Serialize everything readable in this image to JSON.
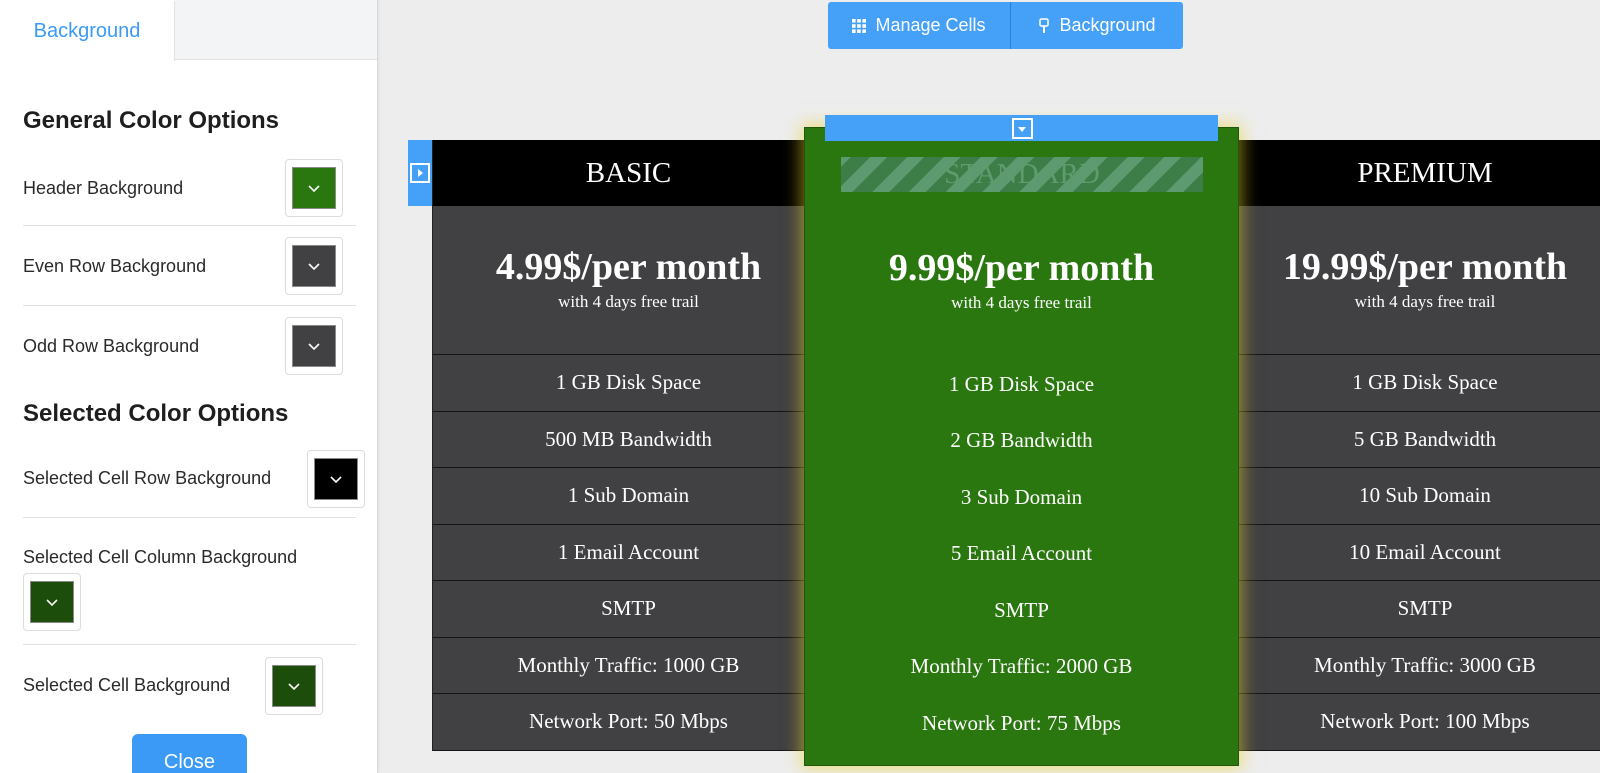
{
  "panel": {
    "tab_label": "Background",
    "general_title": "General Color Options",
    "selected_title": "Selected Color Options",
    "close_label": "Close",
    "options": [
      {
        "label": "Header Background",
        "color": "#2a7710"
      },
      {
        "label": "Even Row Background",
        "color": "#414042"
      },
      {
        "label": "Odd Row Background",
        "color": "#414042"
      },
      {
        "label": "Selected Cell Row Background",
        "color": "#000000"
      },
      {
        "label": "Selected Cell Column Background",
        "color": "#1d4d0a"
      },
      {
        "label": "Selected Cell Background",
        "color": "#1d4d0a"
      }
    ]
  },
  "toolbar": {
    "manage_cells_label": "Manage Cells",
    "background_label": "Background"
  },
  "table": {
    "columns": [
      {
        "name": "BASIC",
        "price": "4.99$/per month",
        "trail": "with 4 days free trail",
        "features": [
          "1 GB Disk Space",
          "500 MB Bandwidth",
          "1 Sub Domain",
          "1 Email Account",
          "SMTP",
          "Monthly Traffic: 1000 GB",
          "Network Port: 50 Mbps"
        ]
      },
      {
        "name": "STANDARD",
        "price": "9.99$/per month",
        "trail": "with 4 days free trail",
        "features": [
          "1 GB Disk Space",
          "2 GB Bandwidth",
          "3 Sub Domain",
          "5 Email Account",
          "SMTP",
          "Monthly Traffic: 2000 GB",
          "Network Port: 75 Mbps"
        ]
      },
      {
        "name": "PREMIUM",
        "price": "19.99$/per month",
        "trail": "with 4 days free trail",
        "features": [
          "1 GB Disk Space",
          "5 GB Bandwidth",
          "10 Sub Domain",
          "10 Email Account",
          "SMTP",
          "Monthly Traffic: 3000 GB",
          "Network Port: 100 Mbps"
        ]
      }
    ]
  },
  "colors": {
    "accent": "#45a0f7",
    "header": "#000000",
    "row": "#414042",
    "selected_column": "#2a7710"
  }
}
